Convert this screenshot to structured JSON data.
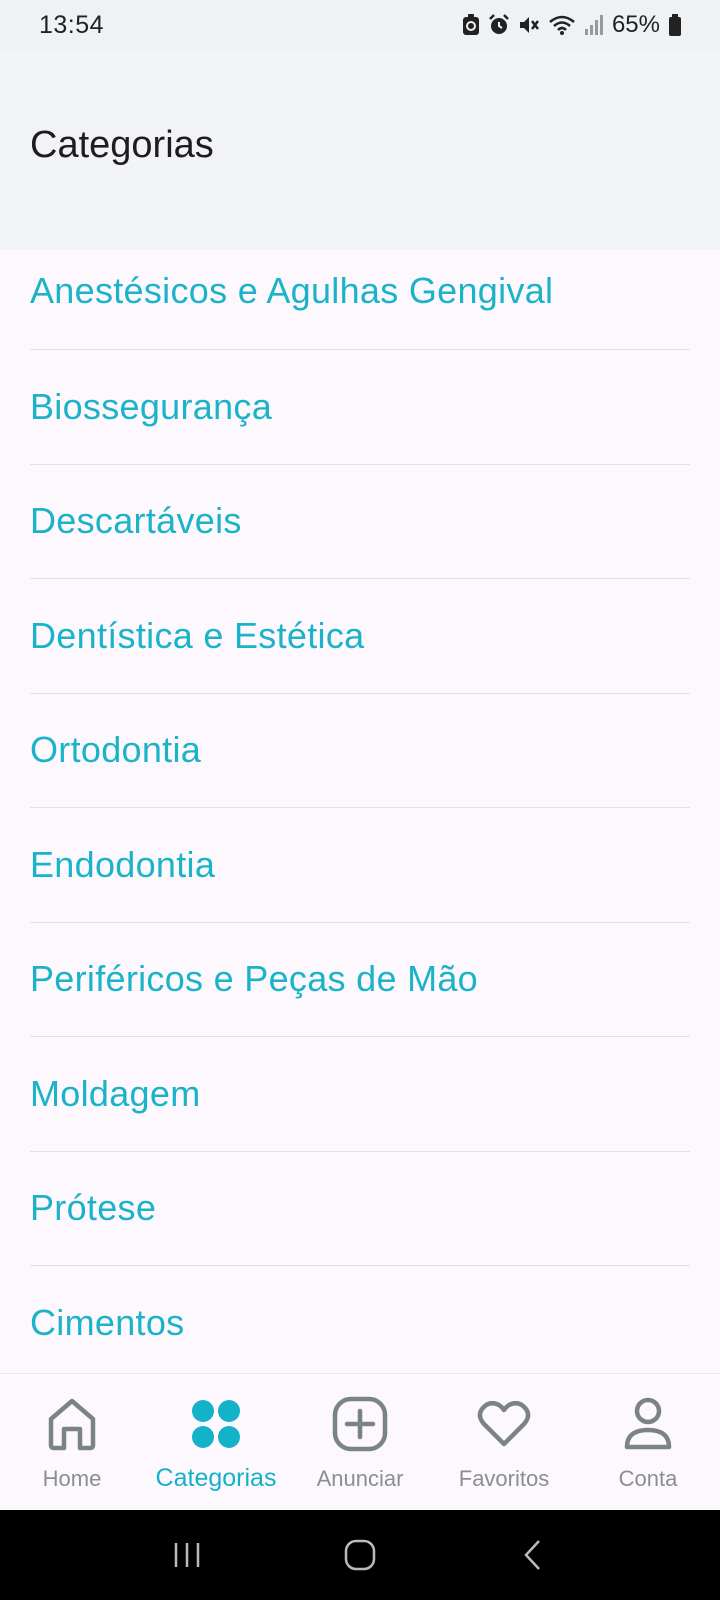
{
  "status_bar": {
    "time": "13:54",
    "battery_percent": "65%",
    "icons": [
      "sync-icon",
      "alarm-icon",
      "mute-icon",
      "wifi-icon",
      "signal-icon",
      "battery-icon"
    ]
  },
  "header": {
    "title": "Categorias"
  },
  "categories": [
    {
      "label": "Anestésicos e Agulhas Gengival"
    },
    {
      "label": "Biossegurança"
    },
    {
      "label": "Descartáveis"
    },
    {
      "label": "Dentística e Estética"
    },
    {
      "label": "Ortodontia"
    },
    {
      "label": "Endodontia"
    },
    {
      "label": "Periféricos e Peças de Mão"
    },
    {
      "label": "Moldagem"
    },
    {
      "label": "Prótese"
    },
    {
      "label": "Cimentos"
    }
  ],
  "bottom_nav": {
    "items": [
      {
        "label": "Home",
        "icon": "home-icon"
      },
      {
        "label": "Categorias",
        "icon": "categories-icon",
        "active": true
      },
      {
        "label": "Anunciar",
        "icon": "add-icon"
      },
      {
        "label": "Favoritos",
        "icon": "heart-icon"
      },
      {
        "label": "Conta",
        "icon": "account-icon"
      }
    ]
  },
  "colors": {
    "accent": "#1bb3c8",
    "inactive": "#8a8f91",
    "header_bg": "#f1f3f4",
    "page_bg": "#fdf8fd"
  }
}
